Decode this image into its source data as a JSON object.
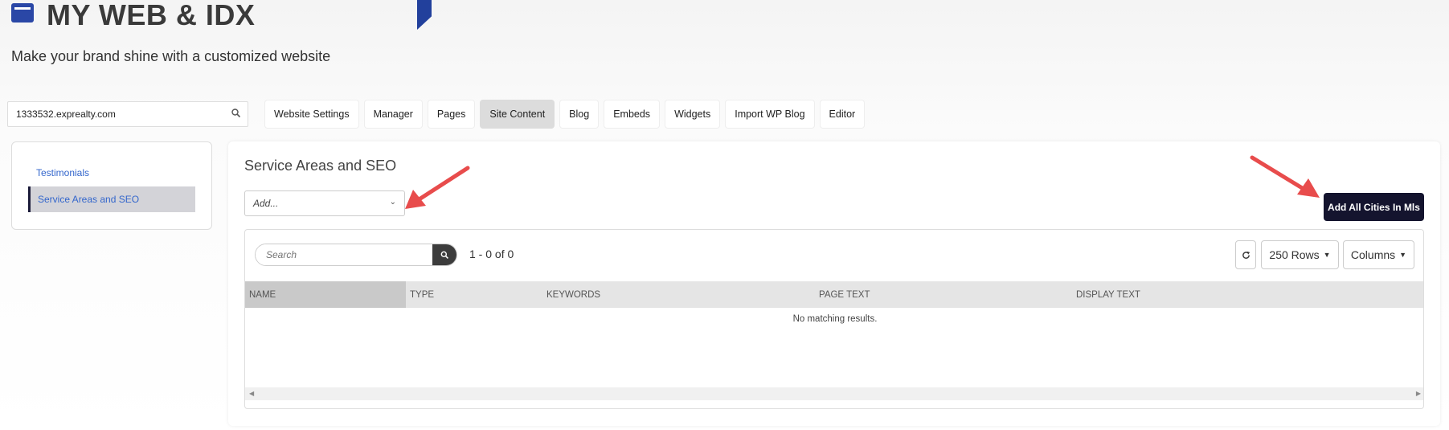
{
  "header": {
    "title": "MY WEB & IDX",
    "subtitle": "Make your brand shine with a customized website"
  },
  "domain_selector": {
    "value": "1333532.exprealty.com"
  },
  "tabs": [
    {
      "label": "Website Settings"
    },
    {
      "label": "Manager"
    },
    {
      "label": "Pages"
    },
    {
      "label": "Site Content",
      "active": true
    },
    {
      "label": "Blog"
    },
    {
      "label": "Embeds"
    },
    {
      "label": "Widgets"
    },
    {
      "label": "Import WP Blog"
    },
    {
      "label": "Editor"
    }
  ],
  "sidebar": {
    "items": [
      {
        "label": "Testimonials"
      },
      {
        "label": "Service Areas and SEO",
        "active": true
      }
    ]
  },
  "main": {
    "section_title": "Service Areas and SEO",
    "add_select": {
      "value": "Add..."
    },
    "add_all_cities_label": "Add All Cities In Mls"
  },
  "table": {
    "search_placeholder": "Search",
    "result_count": "1 - 0 of 0",
    "rows_label": "250 Rows",
    "columns_label": "Columns",
    "headers": [
      "NAME",
      "TYPE",
      "KEYWORDS",
      "PAGE TEXT",
      "DISPLAY TEXT"
    ],
    "empty_message": "No matching results."
  },
  "colors": {
    "brand_blue": "#2a47a6",
    "dark_button": "#14142e",
    "annotation_arrow": "#e84c4c"
  }
}
